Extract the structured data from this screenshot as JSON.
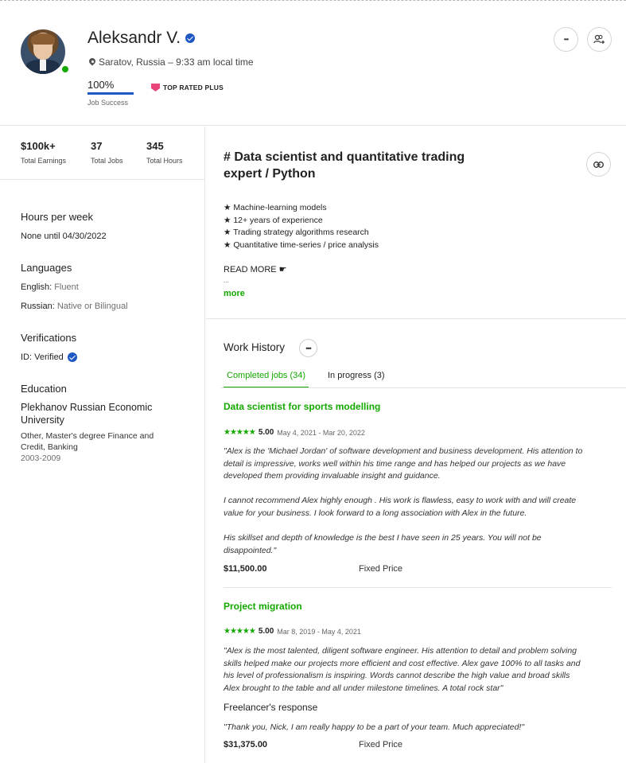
{
  "profile": {
    "name": "Aleksandr V.",
    "location": "Saratov, Russia – 9:33 am local time",
    "job_success_pct": "100%",
    "job_success_label": "Job Success",
    "job_success_value": 1.0,
    "badge_label": "TOP RATED PLUS",
    "online_status": "online"
  },
  "header_actions": {
    "more_icon": "more-horizontal-icon",
    "more_glyph": "•••",
    "invite_icon": "add-user-icon",
    "invite_glyph": "👥⁺"
  },
  "stats": [
    {
      "value": "$100k+",
      "label": "Total Earnings"
    },
    {
      "value": "37",
      "label": "Total Jobs"
    },
    {
      "value": "345",
      "label": "Total Hours"
    }
  ],
  "sidebar": {
    "hours_heading": "Hours per week",
    "hours_value": "None until 04/30/2022",
    "languages_heading": "Languages",
    "languages": [
      {
        "name": "English:",
        "level": "Fluent"
      },
      {
        "name": "Russian:",
        "level": "Native or Bilingual"
      }
    ],
    "verifications_heading": "Verifications",
    "id_label": "ID: Verified",
    "education_heading": "Education",
    "school": "Plekhanov Russian Economic University",
    "degree": "Other, Master's degree Finance and Credit, Banking",
    "years": "2003-2009"
  },
  "overview": {
    "title": "# Data scientist and quantitative trading expert / Python",
    "bullets": [
      "★ Machine-learning models",
      "★ 12+ years of experience",
      "★ Trading strategy algorithms research",
      "★ Quantitative time-series / price analysis"
    ],
    "read_more": "READ MORE ☛",
    "ellipsis": "...",
    "more_link": "more",
    "link_glyph": "⊖"
  },
  "work_history": {
    "title": "Work History",
    "dots": "•••",
    "tabs": [
      {
        "label": "Completed jobs (34)",
        "active": true
      },
      {
        "label": "In progress (3)",
        "active": false
      }
    ],
    "jobs": [
      {
        "title": "Data scientist for sports modelling",
        "stars": "★★★★★",
        "score": "5.00",
        "dates": "May 4, 2021 - Mar 20, 2022",
        "feedback_lines": [
          "\"Alex is the 'Michael Jordan' of software development and business development. His attention to",
          "detail is impressive, works well within his time range and has helped our projects as we have",
          "developed them providing invaluable insight and guidance.",
          "",
          "I cannot recommend Alex highly enough . His work is flawless, easy to work with and will create",
          "value for your business. I look forward to a long association with Alex in the future.",
          "",
          "His skillset and depth of knowledge is the best I have seen in 25 years. You will not be",
          "disappointed.\""
        ],
        "amount": "$11,500.00",
        "price_type": "Fixed Price"
      },
      {
        "title": "Project migration",
        "stars": "★★★★★",
        "score": "5.00",
        "dates": "Mar 8, 2019 - May 4, 2021",
        "feedback_lines": [
          "\"Alex is the most talented, diligent software engineer. His attention to detail and problem solving",
          "skills helped make our projects more efficient and cost effective. Alex gave 100% to all tasks and",
          "his level of professionalism is inspiring. Words cannot describe the high value and broad skills",
          "Alex brought to the table and all under milestone timelines. A total rock star\""
        ],
        "response_heading": "Freelancer's response",
        "response": "\"Thank you, Nick, I am really happy to be a part of your team. Much appreciated!\"",
        "amount": "$31,375.00",
        "price_type": "Fixed Price"
      }
    ]
  },
  "colors": {
    "accent_green": "#14a800",
    "verified_blue": "#1f57c3",
    "badge_pink": "#e8457a"
  }
}
